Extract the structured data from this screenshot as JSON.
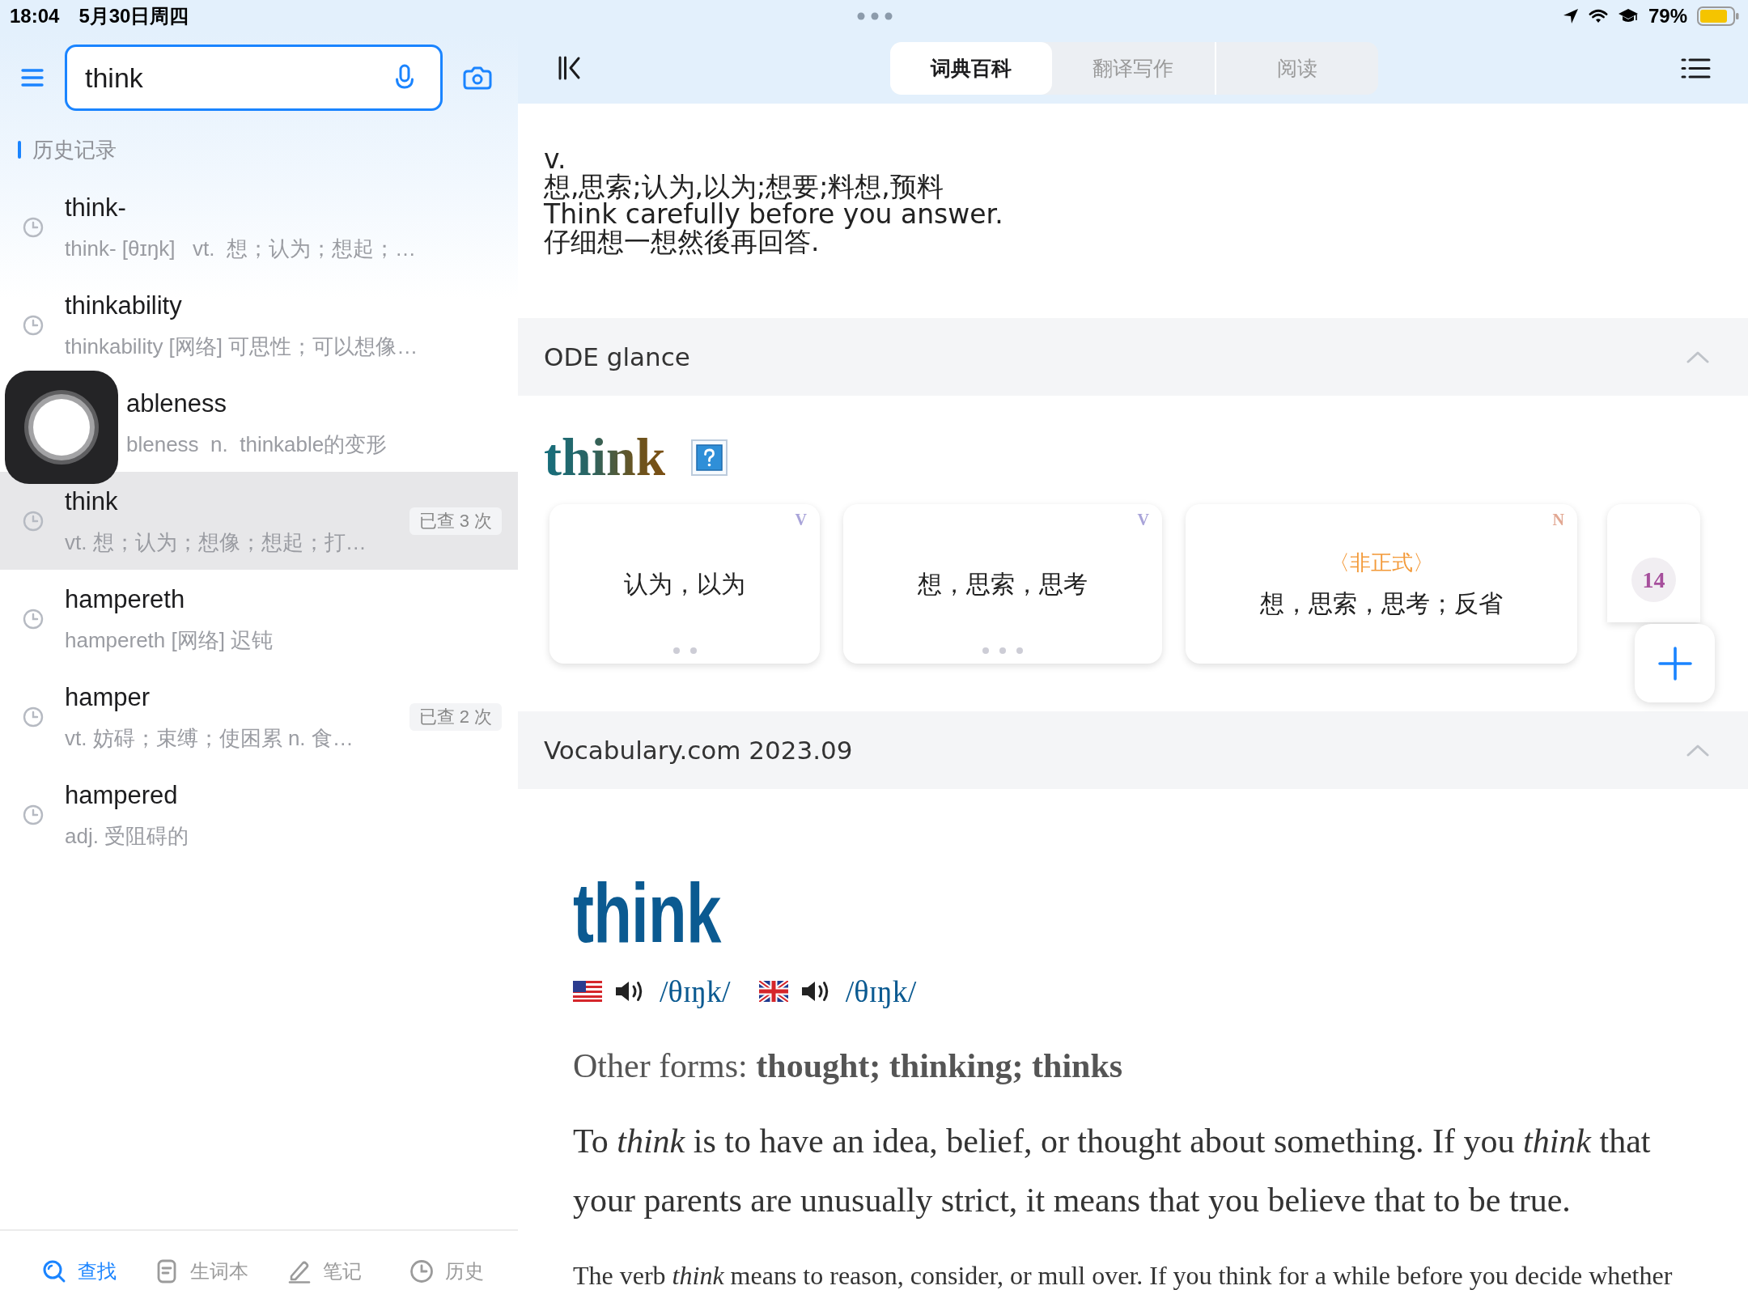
{
  "status_bar": {
    "time": "18:04",
    "date": "5月30日周四",
    "battery": "79%"
  },
  "sidebar": {
    "search": {
      "value": "think"
    },
    "history_title": "历史记录",
    "history": [
      {
        "title": "think-",
        "subtitle": "think- [θɪŋk]   vt.  想；认为；想起；…",
        "selected": false,
        "under_floating_button": false
      },
      {
        "title": "thinkability",
        "subtitle": "thinkability [网络] 可思性；可以想像…",
        "selected": false,
        "under_floating_button": false
      },
      {
        "title": "ableness",
        "subtitle": "bleness  n.  thinkable的变形",
        "selected": false,
        "under_floating_button": true
      },
      {
        "title": "think",
        "subtitle": "vt. 想；认为；想像；想起；打…",
        "lookups": "已查 3 次",
        "selected": true,
        "under_floating_button": false
      },
      {
        "title": "hampereth",
        "subtitle": "hampereth [网络] 迟钝",
        "selected": false,
        "under_floating_button": false
      },
      {
        "title": "hamper",
        "subtitle": "vt. 妨碍；束缚；使困累 n. 食…",
        "lookups": "已查 2 次",
        "selected": false,
        "under_floating_button": false
      },
      {
        "title": "hampered",
        "subtitle": "adj. 受阻碍的",
        "selected": false,
        "under_floating_button": false
      }
    ],
    "bottom_nav": [
      {
        "kind": "search",
        "label": "查找",
        "selected": true
      },
      {
        "kind": "wordbook",
        "label": "生词本",
        "selected": false
      },
      {
        "kind": "notes",
        "label": "笔记",
        "selected": false
      },
      {
        "kind": "history",
        "label": "历史",
        "selected": false
      }
    ]
  },
  "toolbar": {
    "tabs": [
      {
        "label": "词典百科",
        "selected": true
      },
      {
        "label": "翻译写作",
        "selected": false
      },
      {
        "label": "阅读",
        "selected": false
      }
    ]
  },
  "entry": {
    "pos": "v.",
    "definition": "想,思索;认为,以为;想要;料想,预料",
    "example": "Think carefully before you answer.",
    "translation": "仔细想一想然後再回答."
  },
  "ode": {
    "title": "ODE glance",
    "expanded": true,
    "headword": "think",
    "cards": [
      {
        "kind": "sense",
        "pos": "V",
        "color": "#a9a4d9",
        "text": "认为，以为",
        "dots": [
          {
            "selected": false
          },
          {
            "selected": false
          }
        ]
      },
      {
        "kind": "sense",
        "pos": "V",
        "color": "#a9a4d9",
        "text": "想，思索，思考",
        "dots": [
          {
            "selected": false
          },
          {
            "selected": false
          },
          {
            "selected": false
          }
        ]
      },
      {
        "kind": "sense",
        "pos": "N",
        "color": "#e2a893",
        "register": "〈非正式〉",
        "text": "想，思索，思考；反省"
      },
      {
        "kind": "count",
        "count": "14"
      }
    ]
  },
  "vocabulary": {
    "title": "Vocabulary.com 2023.09",
    "expanded": true,
    "headword": "think",
    "pronunciations": [
      {
        "kind": "us",
        "ipa": "/θɪŋk/"
      },
      {
        "kind": "uk",
        "ipa": "/θɪŋk/"
      }
    ],
    "other_forms": "Other forms: **thought; thinking; thinks**",
    "summary": "To *think* is to have an idea, belief, or thought about something. If you *think* that your parents are unusually strict, it means that you believe that to be true.",
    "detail": "The verb *think* means to reason, consider, or mull over. If you think for a while before you decide whether"
  }
}
